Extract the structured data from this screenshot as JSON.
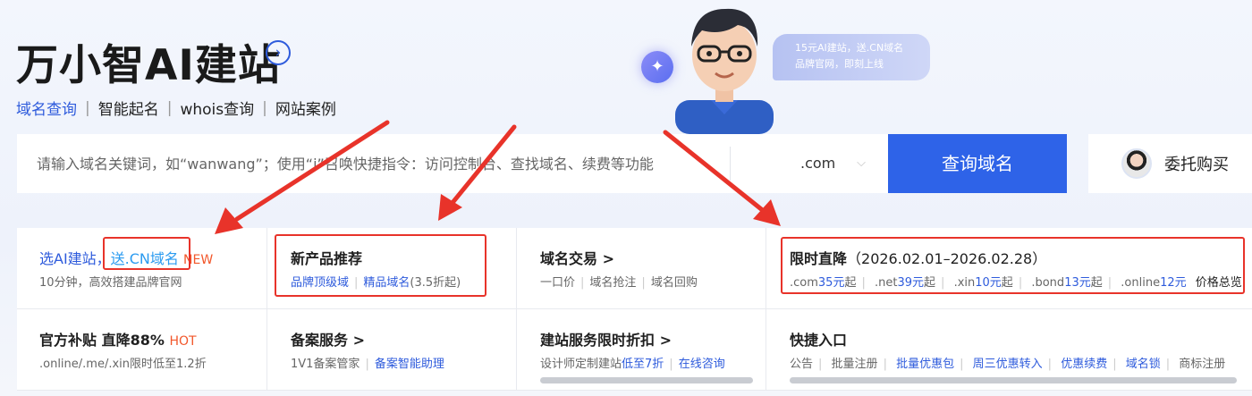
{
  "header": {
    "title": "万小智AI建站",
    "title_arrow_icon": "chevron-right-circle-icon",
    "nav": [
      "域名查询",
      "智能起名",
      "whois查询",
      "网站案例"
    ],
    "nav_active_index": 0
  },
  "promo": {
    "bubble_line1": "15元AI建站，送.CN域名",
    "bubble_line2": "品牌官网，即刻上线",
    "sparkle_icon": "sparkle-icon",
    "mascot_icon": "mascot-boy-glasses-icon"
  },
  "search": {
    "placeholder": "请输入域名关键词，如“wanwang”；使用“i”召唤快捷指令：访问控制台、查找域名、续费等功能",
    "tld": ".com",
    "tld_chevron_icon": "chevron-down-icon",
    "button": "查询域名",
    "entrust": "委托购买"
  },
  "cards": {
    "ai": {
      "pre": "选AI建站，",
      "cn": "送.CN域名",
      "badge": "NEW",
      "sub": "10分钟，高效搭建品牌官网"
    },
    "newprod": {
      "title": "新产品推荐",
      "link1": "品牌顶级域",
      "link2": "精品域名",
      "note": "(3.5折起)"
    },
    "trade": {
      "title": "域名交易 >",
      "links": [
        "一口价",
        "域名抢注",
        "域名回购"
      ]
    },
    "sale": {
      "title": "限时直降",
      "date": "（2026.02.01–2026.02.28）",
      "items": [
        {
          "tld": ".com",
          "price": "35元",
          "suffix": "起"
        },
        {
          "tld": ".net",
          "price": "39元",
          "suffix": "起"
        },
        {
          "tld": ".xin",
          "price": "10元",
          "suffix": "起"
        },
        {
          "tld": ".bond",
          "price": "13元",
          "suffix": "起"
        },
        {
          "tld": ".online",
          "price": "12元",
          "suffix": ""
        }
      ],
      "overview": "价格总览"
    },
    "subsidy": {
      "title": "官方补贴 直降88%",
      "badge": "HOT",
      "sub": ".online/.me/.xin限时低至1.2折"
    },
    "filing": {
      "title": "备案服务 >",
      "plain": "1V1备案管家",
      "link": "备案智能助理"
    },
    "build": {
      "title": "建站服务限时折扣 >",
      "pre": "设计师定制建站",
      "discount": "低至7折",
      "link": "在线咨询"
    },
    "quick": {
      "title": "快捷入口",
      "links": [
        {
          "label": "公告",
          "blue": false
        },
        {
          "label": "批量注册",
          "blue": false
        },
        {
          "label": "批量优惠包",
          "blue": true
        },
        {
          "label": "周三优惠转入",
          "blue": true
        },
        {
          "label": "优惠续费",
          "blue": true
        },
        {
          "label": "域名锁",
          "blue": true
        },
        {
          "label": "商标注册",
          "blue": false
        }
      ]
    }
  },
  "colors": {
    "primary": "#2e63e8",
    "link": "#2e5bdc",
    "accent_orange": "#f2572b",
    "annotation_red": "#e8332a"
  }
}
